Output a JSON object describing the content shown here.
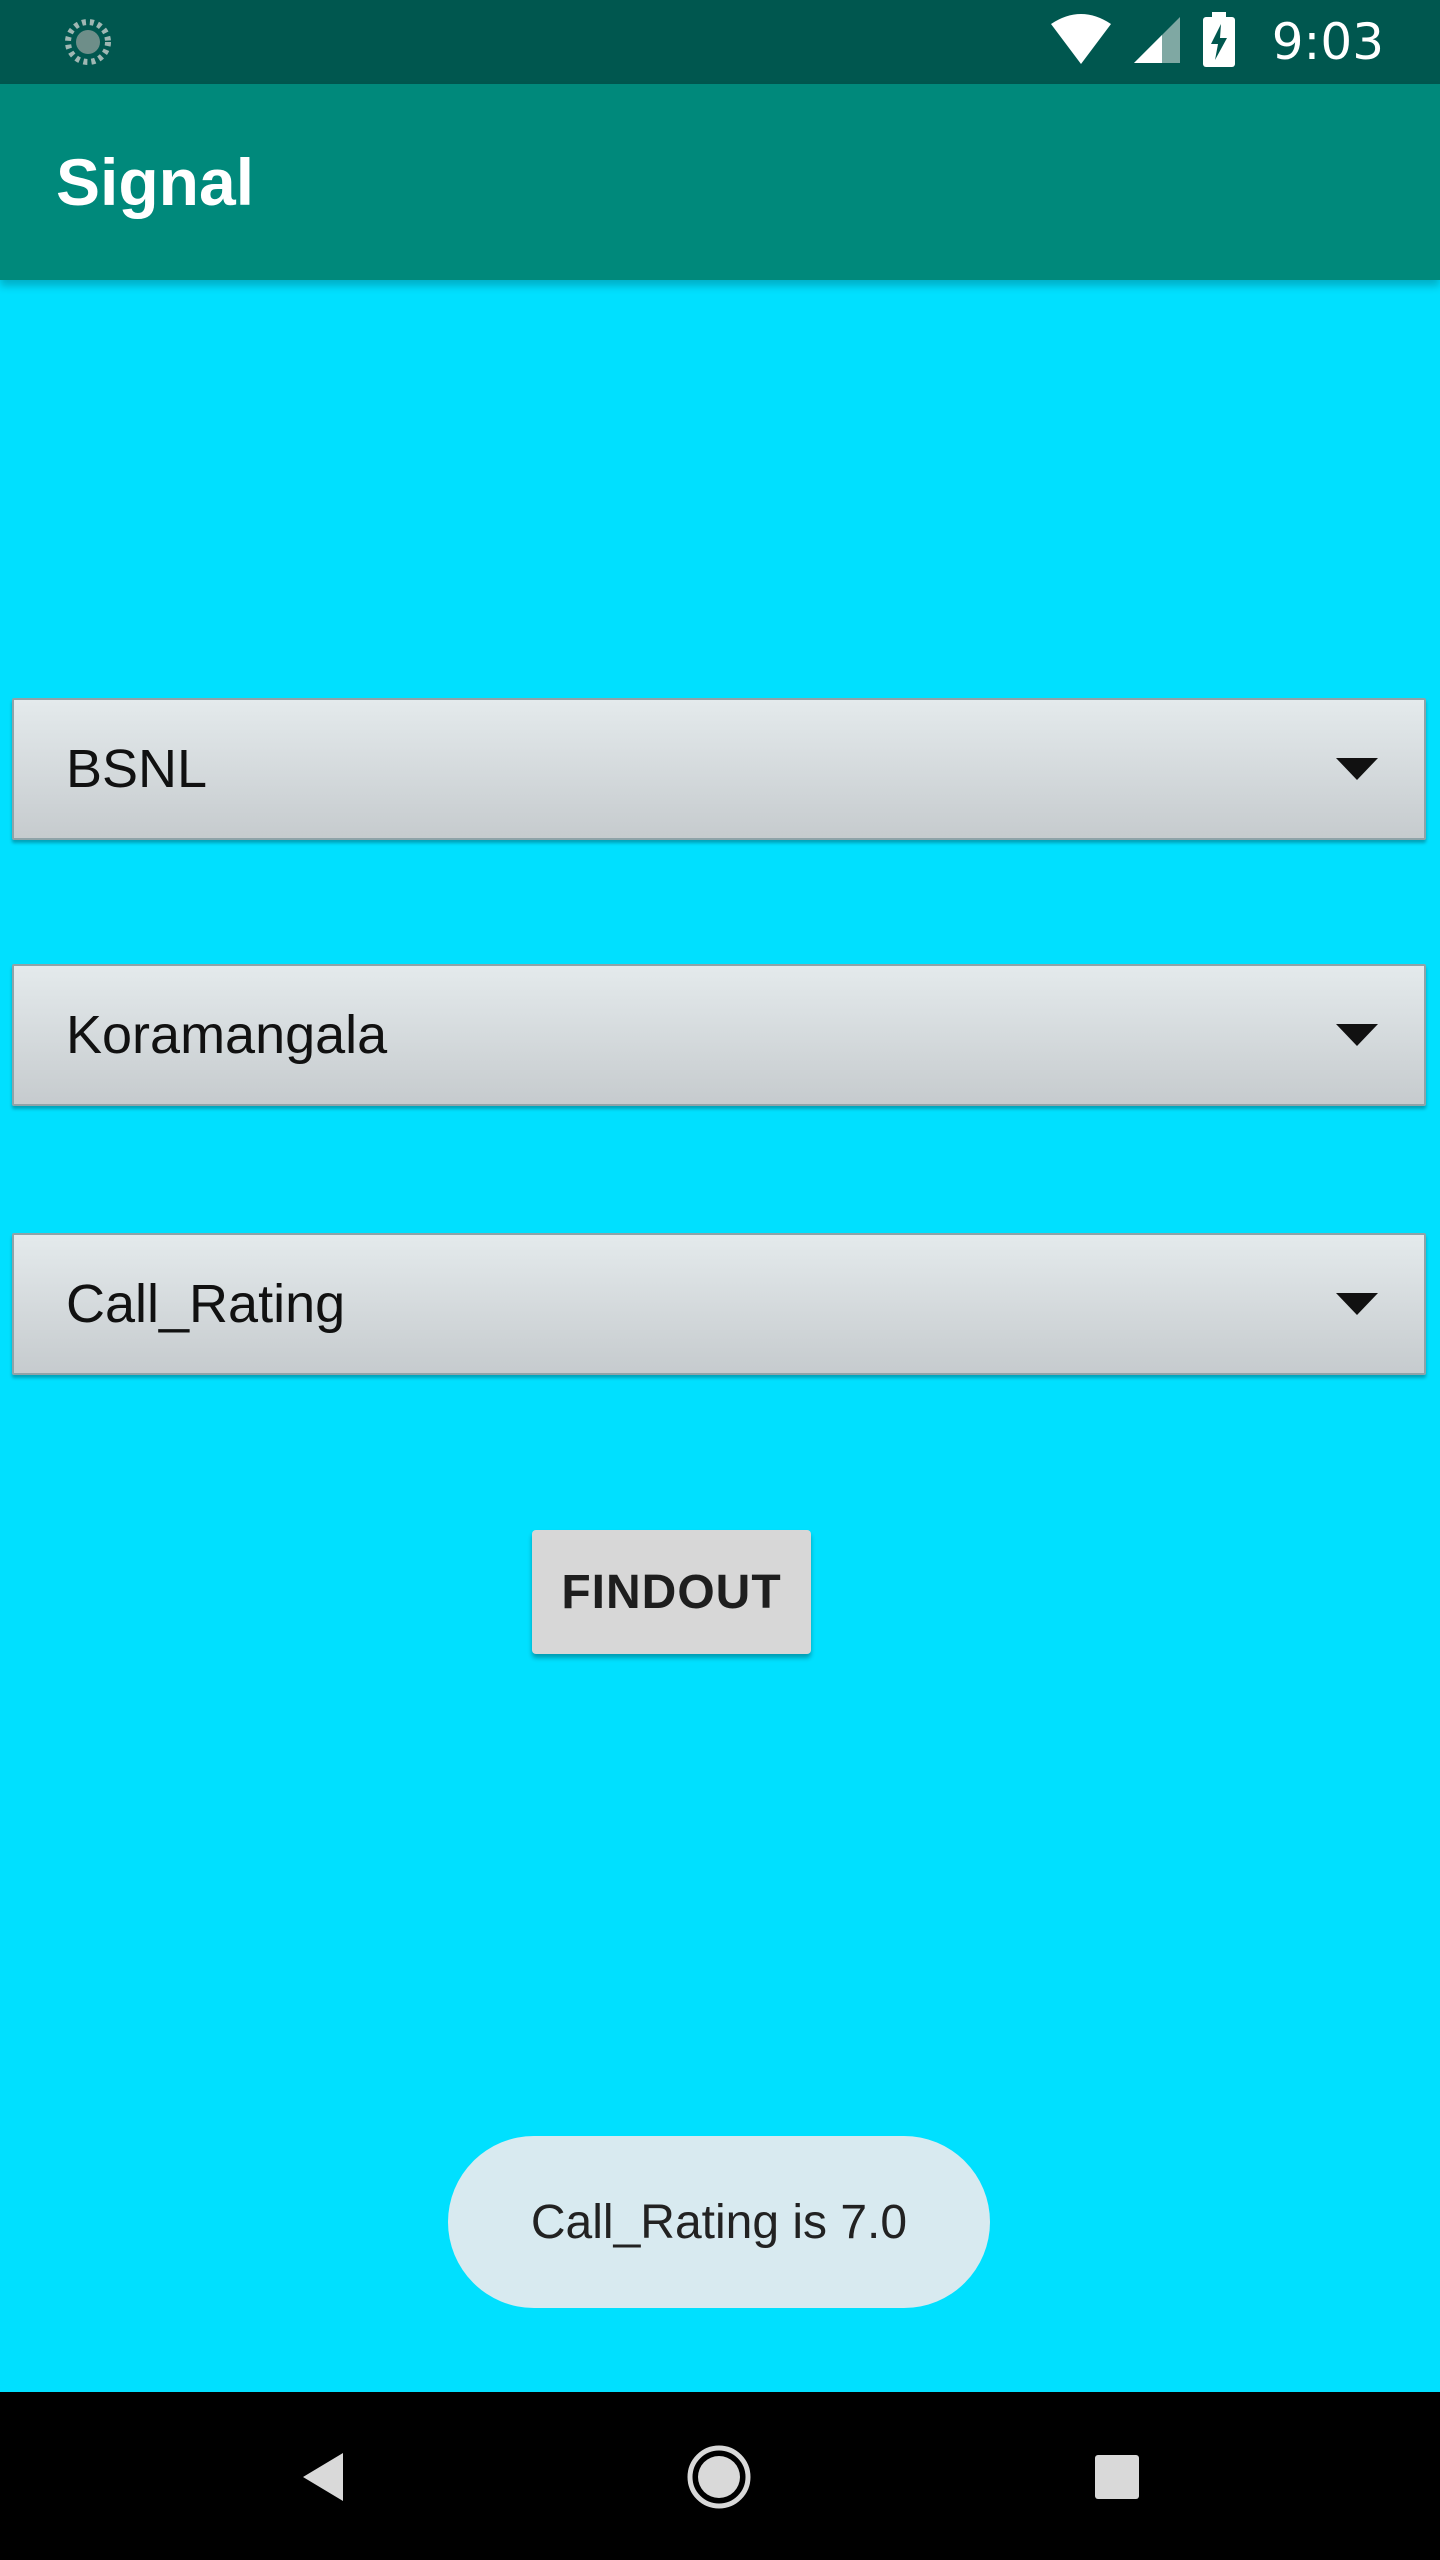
{
  "status_bar": {
    "time": "9:03",
    "icons": [
      "loading-icon",
      "wifi-icon",
      "cellular-signal-icon",
      "battery-charging-icon"
    ]
  },
  "app_bar": {
    "title": "Signal"
  },
  "spinners": {
    "operator": "BSNL",
    "area": "Koramangala",
    "parameter": "Call_Rating"
  },
  "find_button": {
    "label": "FINDOUT"
  },
  "toast": {
    "message": "Call_Rating is 7.0"
  },
  "nav_bar": {
    "icons": [
      "back-icon",
      "home-icon",
      "recents-icon"
    ]
  },
  "colors": {
    "status_bar": "#00574F",
    "app_bar": "#00897B",
    "background": "#00E0FF",
    "spinner": "#D9DFE1",
    "button": "#D7D7D7",
    "toast": "#D8EAF0",
    "nav_bar": "#000000"
  }
}
